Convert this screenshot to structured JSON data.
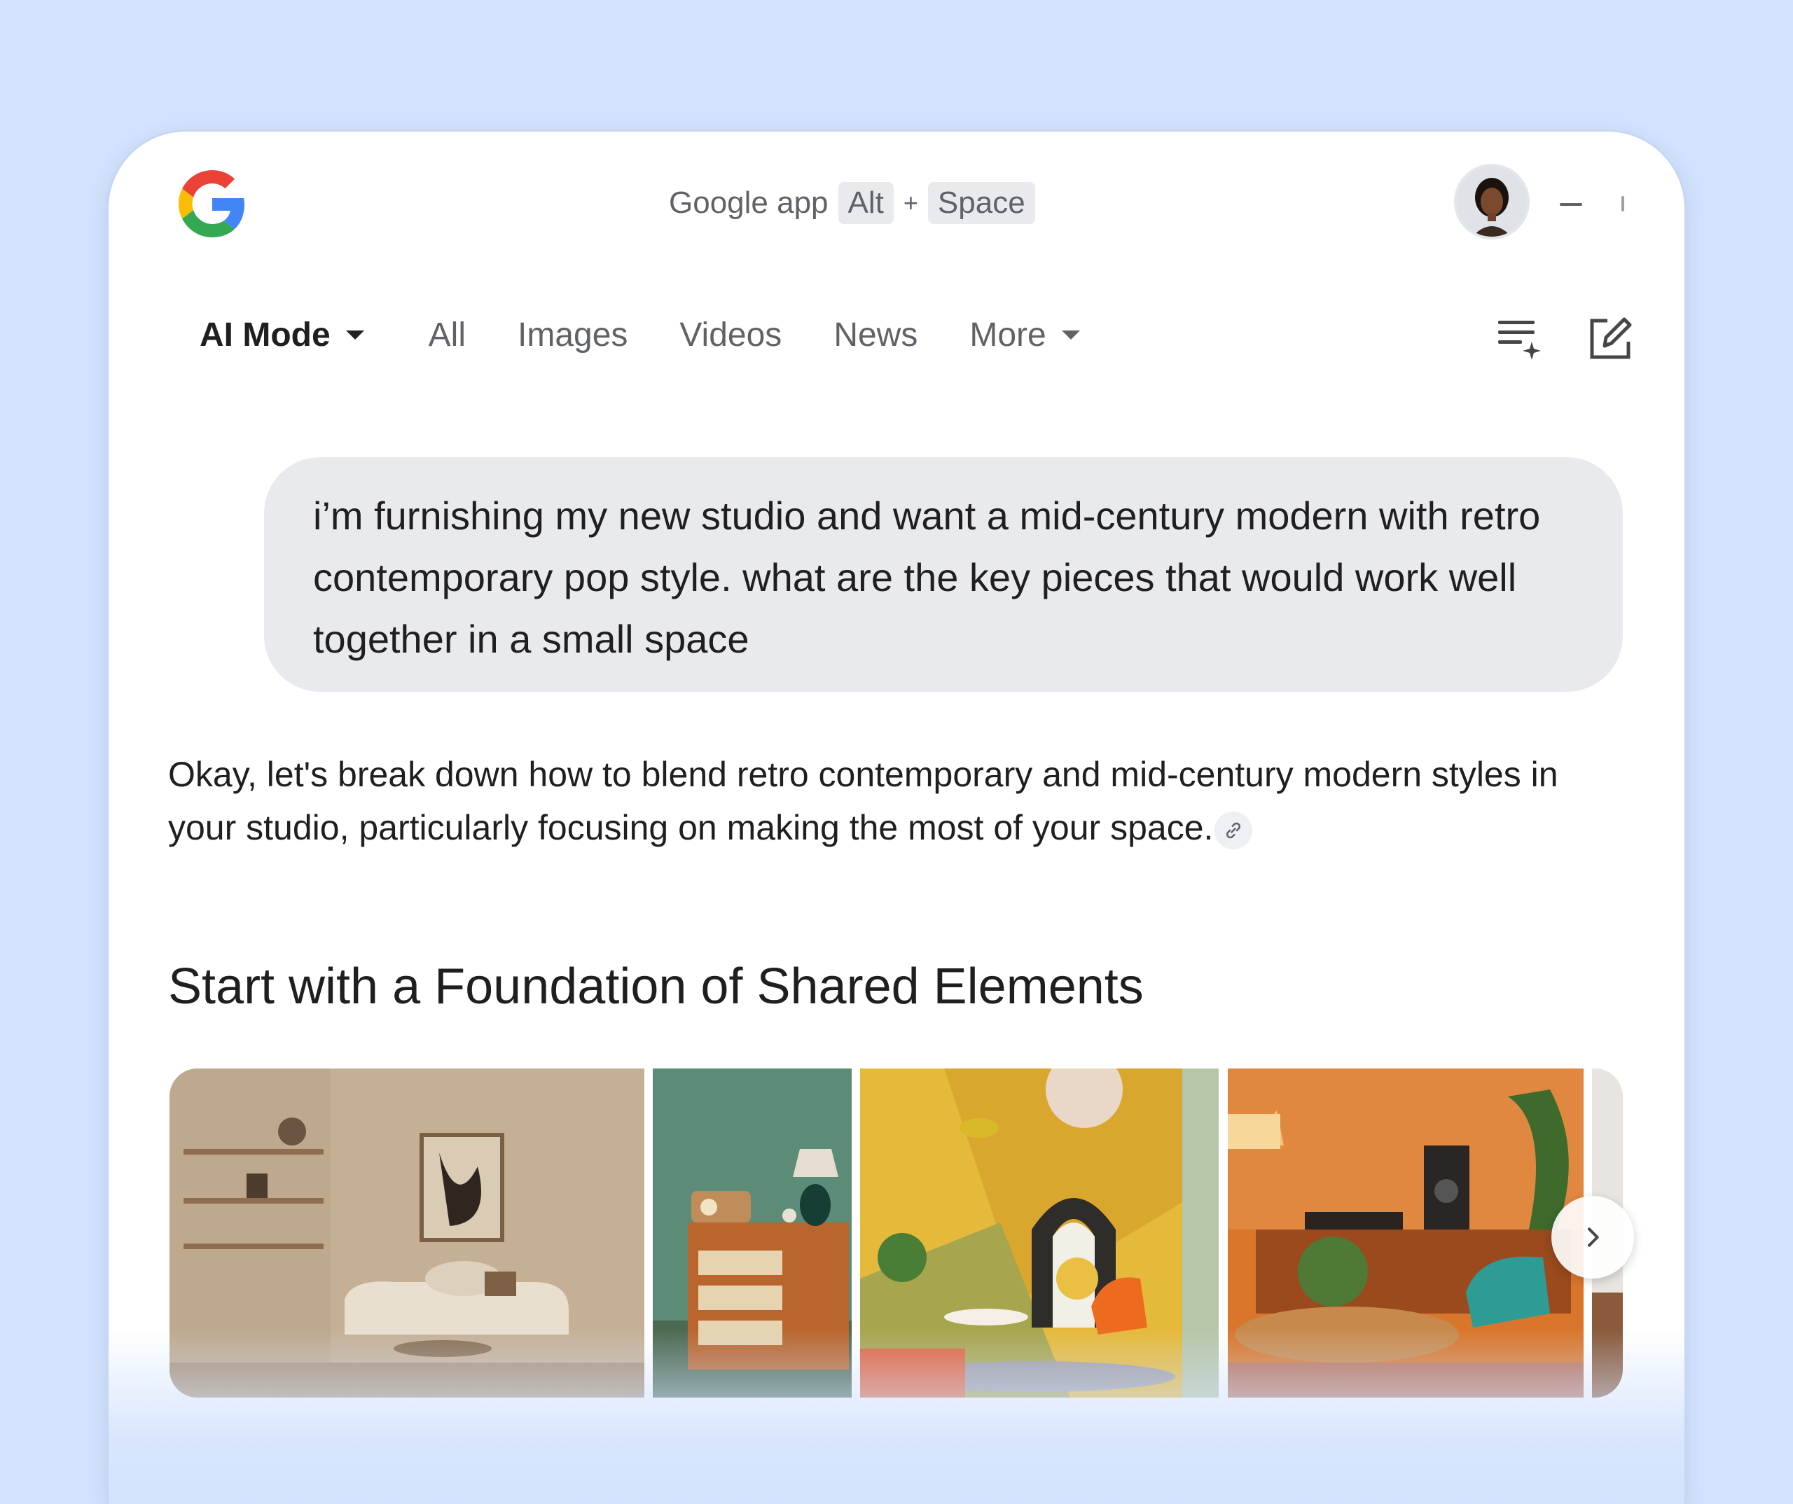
{
  "titlebar": {
    "app_name": "Google app",
    "shortcut_key1": "Alt",
    "shortcut_plus": "+",
    "shortcut_key2": "Space"
  },
  "nav": {
    "tabs": [
      {
        "label": "AI Mode",
        "active": true
      },
      {
        "label": "All"
      },
      {
        "label": "Images"
      },
      {
        "label": "Videos"
      },
      {
        "label": "News"
      },
      {
        "label": "More"
      }
    ]
  },
  "chat": {
    "user_query": "i’m furnishing my new studio and want a mid-century modern with retro contemporary pop style. what are the key pieces that would work well together in a small space",
    "answer_intro": "Okay, let's break down how to blend retro contemporary and mid-century modern styles in your studio, particularly focusing on making the most of your space.",
    "section_heading": "Start with a Foundation of Shared Elements"
  },
  "colors": {
    "page_bg": "#d3e3fd",
    "bubble_bg": "#e9eaed",
    "text_primary": "#1f1f1f",
    "text_secondary": "#5f6368"
  }
}
